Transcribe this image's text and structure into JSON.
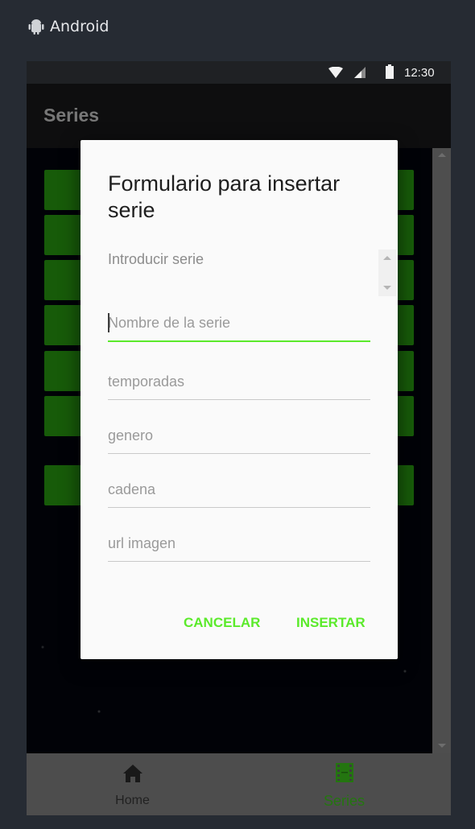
{
  "platform": {
    "label": "Android",
    "icon": "android-icon"
  },
  "status_bar": {
    "time": "12:30"
  },
  "app": {
    "title": "Series"
  },
  "list": {
    "item_count": 7
  },
  "dialog": {
    "title": "Formulario para insertar serie",
    "message": "Introducir serie",
    "fields": {
      "nombre": {
        "placeholder": "Nombre de la serie",
        "value": ""
      },
      "temporadas": {
        "placeholder": "temporadas",
        "value": ""
      },
      "genero": {
        "placeholder": "genero",
        "value": ""
      },
      "cadena": {
        "placeholder": "cadena",
        "value": ""
      },
      "url_imagen": {
        "placeholder": "url imagen",
        "value": ""
      }
    },
    "buttons": {
      "cancel": "CANCELAR",
      "insert": "INSERTAR"
    }
  },
  "bottom_nav": {
    "items": [
      {
        "label": "Home",
        "icon": "home-icon",
        "selected": false
      },
      {
        "label": "Series",
        "icon": "film-icon",
        "selected": true
      }
    ]
  },
  "colors": {
    "accent": "#5bea2b",
    "list_item": "#2aa612",
    "nav_selected": "#43d61e"
  }
}
